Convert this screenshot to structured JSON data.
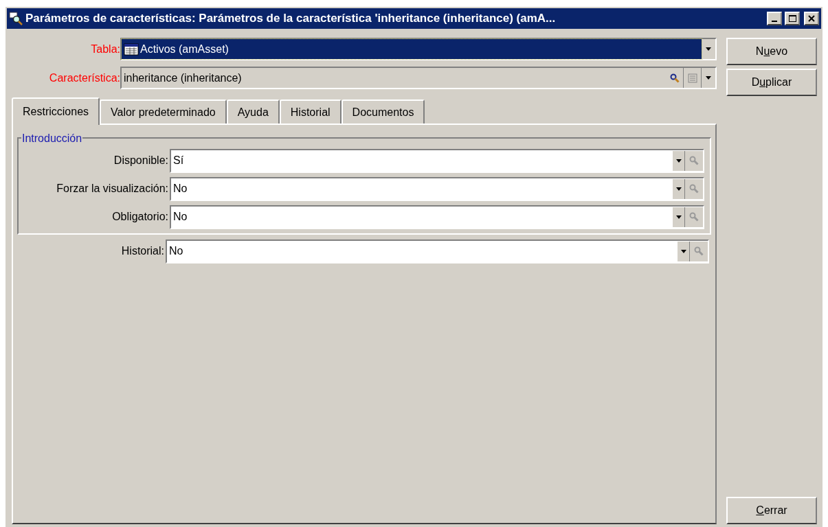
{
  "window": {
    "title": "Parámetros de características: Parámetros de la característica 'inheritance (inheritance) (amA..."
  },
  "fields": [
    {
      "kind": "table-combo",
      "label": "Tabla:",
      "value": "Activos (amAsset)",
      "required": true,
      "focused": true
    },
    {
      "kind": "link-combo",
      "label": "Característica:",
      "value": "inheritance (inheritance)",
      "required": true,
      "focused": false
    }
  ],
  "tabs": [
    {
      "label": "Restricciones",
      "selected": true
    },
    {
      "label": "Valor predeterminado",
      "selected": false
    },
    {
      "label": "Ayuda",
      "selected": false
    },
    {
      "label": "Historial",
      "selected": false
    },
    {
      "label": "Documentos",
      "selected": false
    }
  ],
  "group": {
    "title": "Introducción",
    "rows": [
      {
        "label": "Disponible:",
        "value": "Sí",
        "lookup_disabled": true
      },
      {
        "label": "Forzar la visualización:",
        "value": "No",
        "lookup_disabled": true
      },
      {
        "label": "Obligatorio:",
        "value": "No",
        "lookup_disabled": true
      }
    ]
  },
  "history_row": {
    "label": "Historial:",
    "value": "No",
    "lookup_disabled": true
  },
  "buttons": [
    {
      "label_parts": [
        {
          "text": "N",
          "underlined": false
        },
        {
          "text": "u",
          "underlined": true
        },
        {
          "text": "evo",
          "underlined": false
        }
      ]
    },
    {
      "label_parts": [
        {
          "text": "D",
          "underlined": false
        },
        {
          "text": "u",
          "underlined": true
        },
        {
          "text": "plicar",
          "underlined": false
        }
      ]
    }
  ],
  "close_button": {
    "label_parts": [
      {
        "text": "C",
        "underlined": true
      },
      {
        "text": "errar",
        "underlined": false
      }
    ]
  }
}
